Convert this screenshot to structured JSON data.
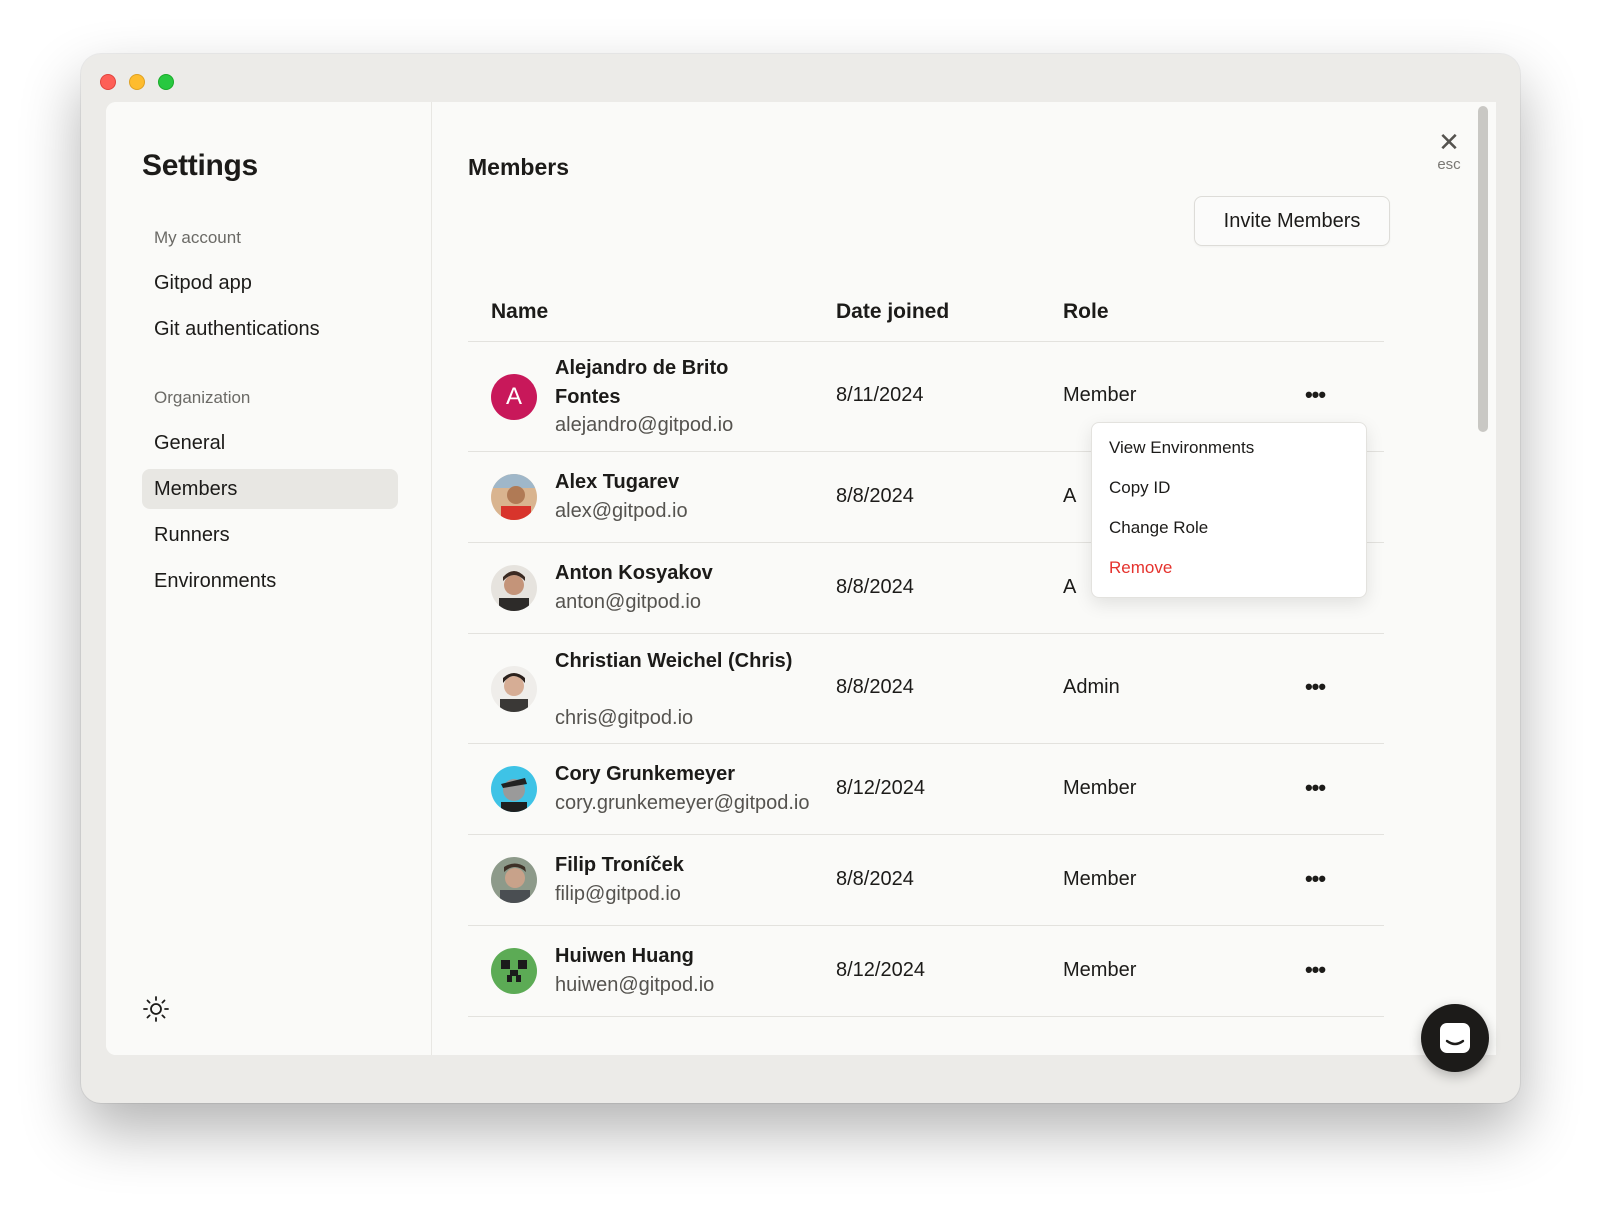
{
  "sidebar": {
    "title": "Settings",
    "sections": [
      {
        "label": "My account",
        "items": [
          "Gitpod app",
          "Git authentications"
        ]
      },
      {
        "label": "Organization",
        "items": [
          "General",
          "Members",
          "Runners",
          "Environments"
        ]
      }
    ],
    "active_item": "Members",
    "theme_icon": "sun-icon"
  },
  "main": {
    "title": "Members",
    "invite_label": "Invite Members",
    "close_hint": "esc"
  },
  "table": {
    "columns": [
      "Name",
      "Date joined",
      "Role"
    ],
    "rows": [
      {
        "name": "Alejandro de Brito Fontes",
        "email": "alejandro@gitpod.io",
        "date": "8/11/2024",
        "role": "Member",
        "avatar_letter": "A"
      },
      {
        "name": "Alex Tugarev",
        "email": "alex@gitpod.io",
        "date": "8/8/2024",
        "role": "A"
      },
      {
        "name": "Anton Kosyakov",
        "email": "anton@gitpod.io",
        "date": "8/8/2024",
        "role": "A"
      },
      {
        "name": "Christian Weichel (Chris)",
        "email": "chris@gitpod.io",
        "date": "8/8/2024",
        "role": "Admin"
      },
      {
        "name": "Cory Grunkemeyer",
        "email": "cory.grunkemeyer@gitpod.io",
        "date": "8/12/2024",
        "role": "Member"
      },
      {
        "name": "Filip Troníček",
        "email": "filip@gitpod.io",
        "date": "8/8/2024",
        "role": "Member"
      },
      {
        "name": "Huiwen Huang",
        "email": "huiwen@gitpod.io",
        "date": "8/12/2024",
        "role": "Member"
      }
    ]
  },
  "context_menu": {
    "items": [
      "View Environments",
      "Copy ID",
      "Change Role",
      "Remove"
    ],
    "danger_color": "#e5322d"
  },
  "colors": {
    "accent_avatar": "#c8185a",
    "sidebar_active": "#e8e7e3"
  }
}
